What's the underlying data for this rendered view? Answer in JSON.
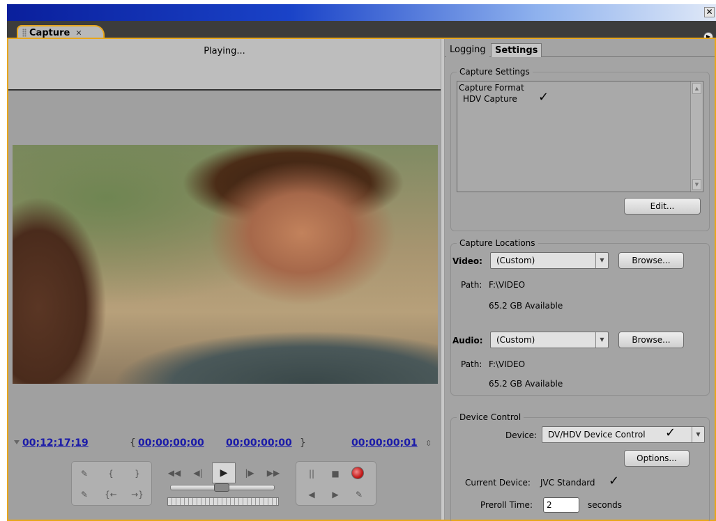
{
  "window": {
    "close_glyph": "✕"
  },
  "panel": {
    "tab_title": "Capture",
    "tab_close": "✕",
    "menu_glyph": "▶"
  },
  "monitor": {
    "status": "Playing...",
    "current_timecode": "00;12;17;19",
    "in_point": "00;00;00;00",
    "out_point": "00;00;00;00",
    "duration": "00;00;00;01",
    "in_bracket": "{",
    "out_bracket": "}"
  },
  "transport": {
    "icons": [
      "set-in-icon",
      "set-out-icon",
      "goto-in-icon",
      "goto-out-icon",
      "rewind-icon",
      "step-back-icon",
      "play-icon",
      "step-forward-icon",
      "fast-forward-icon",
      "pause-icon",
      "stop-icon",
      "record-icon",
      "jog-icon",
      "shuttle-icon"
    ],
    "glyphs": {
      "set_in": "{",
      "set_out": "}",
      "goto_in": "{←",
      "goto_out": "→}",
      "rewind": "◀◀",
      "step_back": "◀|",
      "play": "▶",
      "step_fwd": "|▶",
      "ffwd": "▶▶",
      "pause": "||",
      "stop": "■",
      "prev": "◀",
      "next": "▶",
      "scene": "✎",
      "clip": "✎"
    }
  },
  "tabs": {
    "logging": "Logging",
    "settings": "Settings"
  },
  "capture_settings": {
    "legend": "Capture Settings",
    "line1": "Capture Format",
    "line2": "HDV Capture",
    "check": "✓",
    "edit_button": "Edit..."
  },
  "capture_locations": {
    "legend": "Capture Locations",
    "video": {
      "label": "Video:",
      "value": "(Custom)",
      "browse": "Browse...",
      "path_label": "Path:",
      "path": "F:\\VIDEO",
      "available": "65.2 GB Available"
    },
    "audio": {
      "label": "Audio:",
      "value": "(Custom)",
      "browse": "Browse...",
      "path_label": "Path:",
      "path": "F:\\VIDEO",
      "available": "65.2 GB Available"
    }
  },
  "device_control": {
    "legend": "Device Control",
    "device_label": "Device:",
    "device_value": "DV/HDV Device Control",
    "check": "✓",
    "options_button": "Options...",
    "current_device_label": "Current Device:",
    "current_device": "JVC Standard",
    "preroll_label": "Preroll Time:",
    "preroll_value": "2",
    "preroll_unit": "seconds"
  },
  "colors": {
    "accent": "#e8a61c",
    "timecode": "#1a1aa8",
    "title_gradient_start": "#0a1f9c"
  }
}
